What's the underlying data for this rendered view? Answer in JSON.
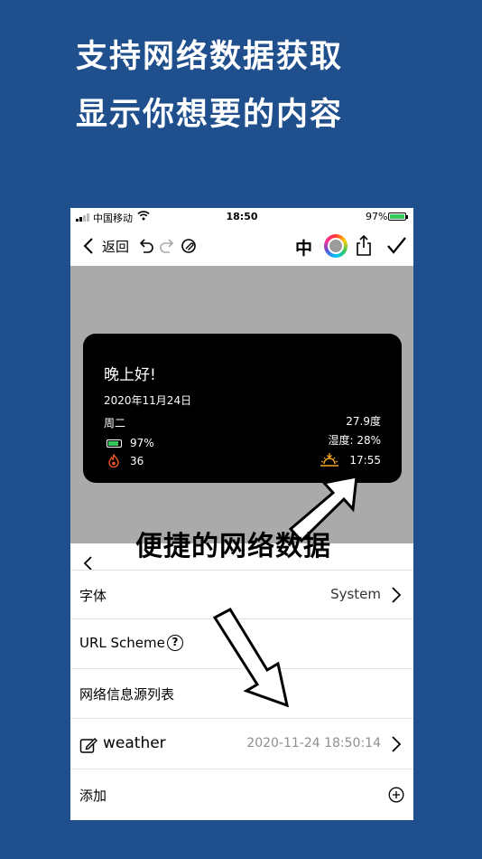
{
  "promo": {
    "line1": "支持网络数据获取",
    "line2": "显示你想要的内容"
  },
  "status_bar": {
    "carrier": "中国移动",
    "time": "18:50",
    "battery": "97%"
  },
  "toolbar": {
    "back_label": "返回",
    "language_label": "中"
  },
  "widget": {
    "greeting": "晚上好!",
    "date": "2020年11月24日",
    "weekday": "周二",
    "battery": "97%",
    "steps": "36",
    "temperature": "27.9度",
    "humidity": "湿度: 28%",
    "sunset_time": "17:55"
  },
  "caption": "便捷的网络数据",
  "settings": {
    "font_label": "字体",
    "font_value": "System",
    "url_scheme_label": "URL Scheme",
    "help_glyph": "?",
    "sources_label": "网络信息源列表",
    "source_name": "weather",
    "source_date": "2020-11-24 18:50:14",
    "add_label": "添加"
  },
  "colors": {
    "background": "#1f4f8d",
    "battery_green": "#34c759",
    "sunset_yellow": "#f5a623",
    "flame_orange": "#ff5a1f"
  }
}
